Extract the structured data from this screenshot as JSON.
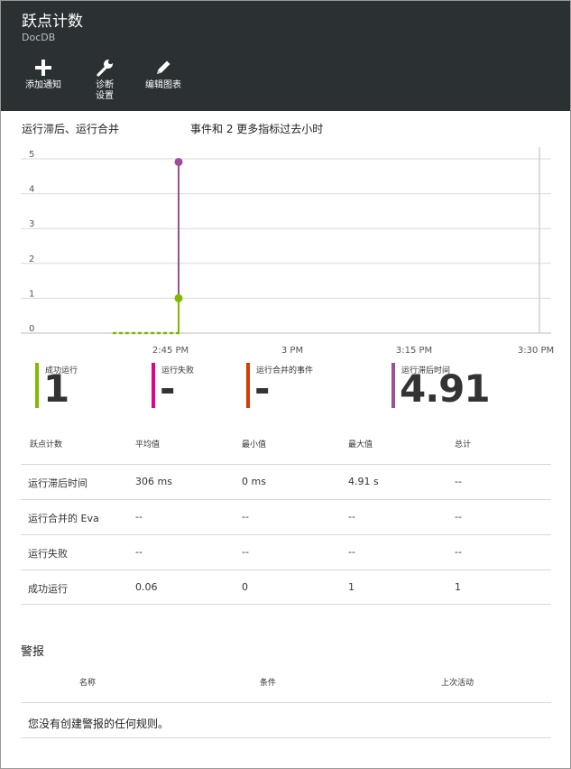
{
  "header": {
    "title": "跃点计数",
    "subtitle": "DocDB",
    "toolbar": [
      {
        "label": "添加通知",
        "icon": "plus-icon"
      },
      {
        "label": "诊断\n设置",
        "icon": "wrench-icon"
      },
      {
        "label": "编辑图表",
        "icon": "pencil-icon"
      }
    ]
  },
  "chart_header": {
    "left": "运行滞后、运行合并",
    "right": "事件和 2 更多指标过去小时"
  },
  "chart_data": {
    "type": "line",
    "x_tick_labels": [
      "2:45 PM",
      "3 PM",
      "3:15 PM",
      "3:30 PM"
    ],
    "y_ticks": [
      0,
      1,
      2,
      3,
      4,
      5
    ],
    "ylim": [
      0,
      5
    ],
    "grid": true,
    "series": [
      {
        "name": "成功运行",
        "color": "#7fba00",
        "style": "dotted-then-solid",
        "points": [
          [
            "2:38 PM",
            0
          ],
          [
            "2:46 PM",
            0
          ],
          [
            "2:46 PM",
            1
          ]
        ]
      },
      {
        "name": "运行滞后时间",
        "color": "#9b4f96",
        "points": [
          [
            "2:46 PM",
            1
          ],
          [
            "2:46 PM",
            4.91
          ]
        ]
      }
    ]
  },
  "tiles": [
    {
      "label": "成功运行",
      "value": "1",
      "color": "#7fba00"
    },
    {
      "label": "运行失败",
      "value": "-",
      "color": "#e3008c"
    },
    {
      "label": "运行合并的事件",
      "value": "-",
      "color": "#d83b01"
    },
    {
      "label": "运行滞后时间",
      "value": "4.91",
      "color": "#9b4f96"
    }
  ],
  "grid": {
    "headers": [
      "跃点计数",
      "平均值",
      "最小值",
      "最大值",
      "总计"
    ],
    "rows": [
      [
        "运行滞后时间",
        "306 ms",
        "0 ms",
        "4.91 s",
        "--"
      ],
      [
        "运行合并的 Eva",
        "--",
        "--",
        "--",
        "--"
      ],
      [
        "运行失败",
        "--",
        "--",
        "--",
        "--"
      ],
      [
        "成功运行",
        "0.06",
        "0",
        "1",
        "1"
      ]
    ]
  },
  "alerts": {
    "title": "警报",
    "headers": [
      "名称",
      "条件",
      "上次活动"
    ],
    "empty_message": "您没有创建警报的任何规则。"
  }
}
